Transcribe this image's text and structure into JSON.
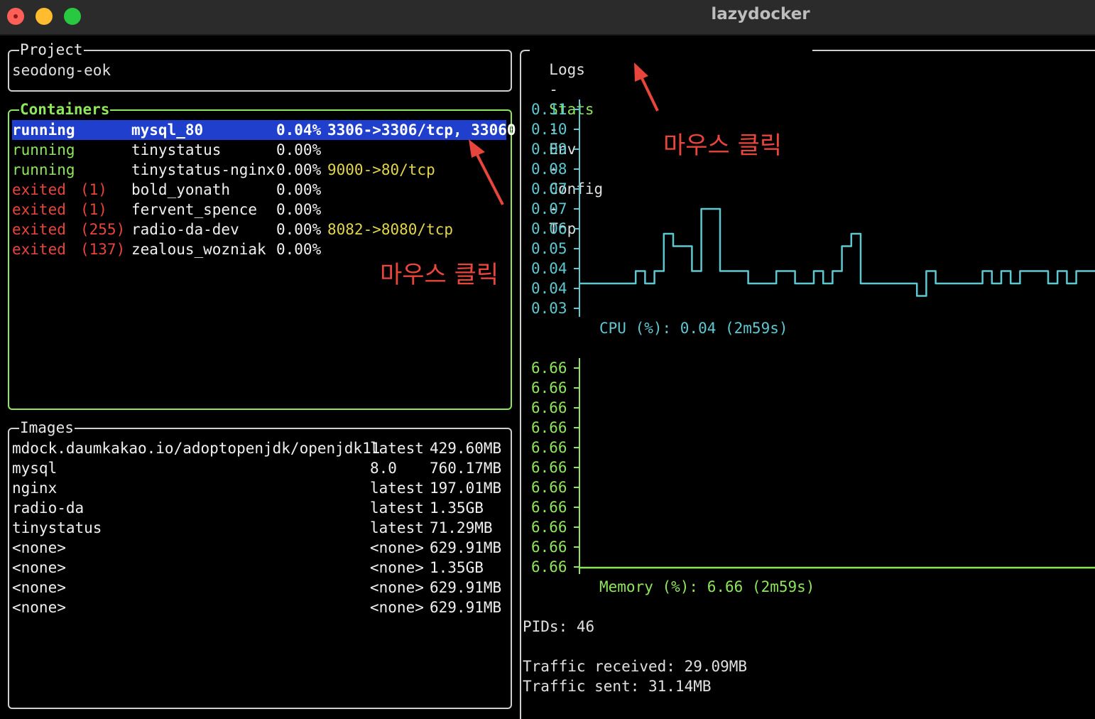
{
  "window": {
    "title": "lazydocker"
  },
  "project": {
    "title": "Project",
    "name": "seodong-eok"
  },
  "containers": {
    "title": "Containers",
    "rows": [
      {
        "status": "running",
        "code": "",
        "name": "mysql_80",
        "cpu": "0.04%",
        "ports": "3306->3306/tcp, 33060",
        "selected": true
      },
      {
        "status": "running",
        "code": "",
        "name": "tinystatus",
        "cpu": "0.00%",
        "ports": ""
      },
      {
        "status": "running",
        "code": "",
        "name": "tinystatus-nginx",
        "cpu": "0.00%",
        "ports": "9000->80/tcp"
      },
      {
        "status": "exited",
        "code": "(1)",
        "name": "bold_yonath",
        "cpu": "0.00%",
        "ports": ""
      },
      {
        "status": "exited",
        "code": "(1)",
        "name": "fervent_spence",
        "cpu": "0.00%",
        "ports": ""
      },
      {
        "status": "exited",
        "code": "(255)",
        "name": "radio-da-dev",
        "cpu": "0.00%",
        "ports": "8082->8080/tcp"
      },
      {
        "status": "exited",
        "code": "(137)",
        "name": "zealous_wozniak",
        "cpu": "0.00%",
        "ports": ""
      }
    ]
  },
  "images": {
    "title": "Images",
    "rows": [
      {
        "repo": "mdock.daumkakao.io/adoptopenjdk/openjdk11",
        "tag": "latest",
        "size": "429.60MB"
      },
      {
        "repo": "mysql",
        "tag": "8.0",
        "size": "760.17MB"
      },
      {
        "repo": "nginx",
        "tag": "latest",
        "size": "197.01MB"
      },
      {
        "repo": "radio-da",
        "tag": "latest",
        "size": "1.35GB"
      },
      {
        "repo": "tinystatus",
        "tag": "latest",
        "size": "71.29MB"
      },
      {
        "repo": "<none>",
        "tag": "<none>",
        "size": "629.91MB"
      },
      {
        "repo": "<none>",
        "tag": "<none>",
        "size": "1.35GB"
      },
      {
        "repo": "<none>",
        "tag": "<none>",
        "size": "629.91MB"
      },
      {
        "repo": "<none>",
        "tag": "<none>",
        "size": "629.91MB"
      }
    ]
  },
  "tabs": {
    "items": [
      "Logs",
      "Stats",
      "Env",
      "Config",
      "Top"
    ],
    "separator": "-",
    "active": "Stats"
  },
  "cpu_chart": {
    "ticks": [
      "0.11",
      "0.10",
      "0.09",
      "0.08",
      "0.07",
      "0.07",
      "0.06",
      "0.05",
      "0.04",
      "0.04",
      "0.03"
    ],
    "label": "CPU (%): 0.04 (2m59s)",
    "color": "#5ec8d0",
    "series": [
      0.04,
      0.04,
      0.04,
      0.04,
      0.04,
      0.04,
      0.045,
      0.04,
      0.045,
      0.06,
      0.055,
      0.055,
      0.045,
      0.07,
      0.07,
      0.045,
      0.045,
      0.045,
      0.04,
      0.04,
      0.04,
      0.045,
      0.045,
      0.04,
      0.04,
      0.045,
      0.04,
      0.045,
      0.055,
      0.06,
      0.04,
      0.04,
      0.04,
      0.04,
      0.04,
      0.04,
      0.035,
      0.045,
      0.04,
      0.04,
      0.04,
      0.04,
      0.04,
      0.045,
      0.04,
      0.045,
      0.04,
      0.045,
      0.045,
      0.045,
      0.04,
      0.045,
      0.04,
      0.045,
      0.045
    ]
  },
  "memory_chart": {
    "ticks": [
      "6.66",
      "6.66",
      "6.66",
      "6.66",
      "6.66",
      "6.66",
      "6.66",
      "6.66",
      "6.66",
      "6.66",
      "6.66"
    ],
    "label": "Memory (%): 6.66 (2m59s)",
    "color": "#8ee65a"
  },
  "stats": {
    "pids": "PIDs: 46",
    "traffic_received": "Traffic received: 29.09MB",
    "traffic_sent": "Traffic sent: 31.14MB"
  },
  "annotations": {
    "left": "마우스 클릭",
    "right": "마우스 클릭",
    "color": "#e8453c"
  }
}
